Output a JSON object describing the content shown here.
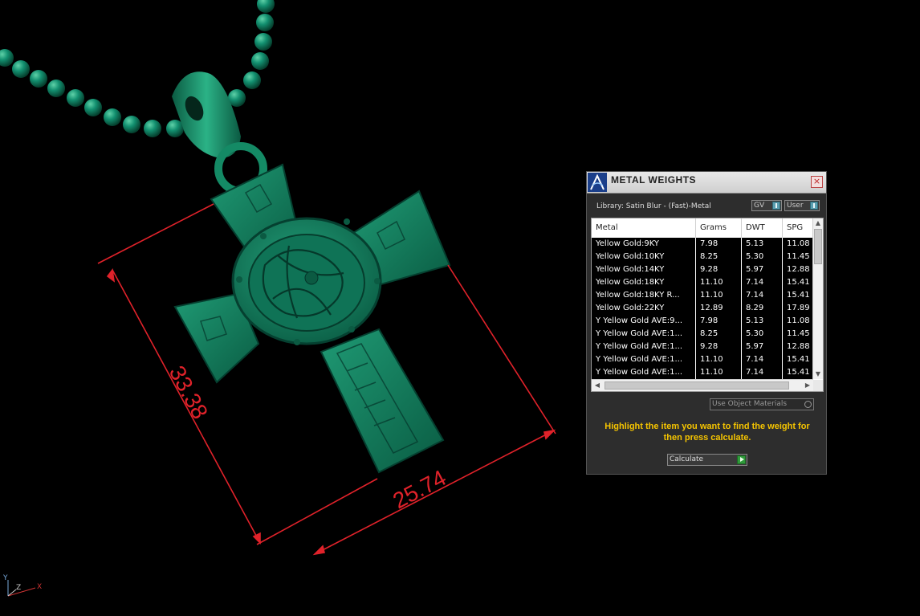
{
  "viewport": {
    "dim_height": "33.38",
    "dim_width": "25.74",
    "axis_z": "Z",
    "axis_x": "X",
    "axis_y": "Y",
    "model_color": "#117a5a",
    "dimension_color": "#e0222a"
  },
  "dialog": {
    "title": "METAL WEIGHTS",
    "close_glyph": "×",
    "library_label": "Library: Satin Blur - (Fast)-Metal",
    "toggle_gv": "GV",
    "toggle_user": "User",
    "columns": [
      "Metal",
      "Grams",
      "DWT",
      "SPG"
    ],
    "rows": [
      [
        "Yellow Gold:9KY",
        "7.98",
        "5.13",
        "11.08"
      ],
      [
        "Yellow Gold:10KY",
        "8.25",
        "5.30",
        "11.45"
      ],
      [
        "Yellow Gold:14KY",
        "9.28",
        "5.97",
        "12.88"
      ],
      [
        "Yellow Gold:18KY",
        "11.10",
        "7.14",
        "15.41"
      ],
      [
        "Yellow Gold:18KY R...",
        "11.10",
        "7.14",
        "15.41"
      ],
      [
        "Yellow Gold:22KY",
        "12.89",
        "8.29",
        "17.89"
      ],
      [
        "Y Yellow Gold AVE:9...",
        "7.98",
        "5.13",
        "11.08"
      ],
      [
        "Y Yellow Gold AVE:1...",
        "8.25",
        "5.30",
        "11.45"
      ],
      [
        "Y Yellow Gold AVE:1...",
        "9.28",
        "5.97",
        "12.88"
      ],
      [
        "Y Yellow Gold AVE:1...",
        "11.10",
        "7.14",
        "15.41"
      ],
      [
        "Y Yellow Gold AVE:1...",
        "11.10",
        "7.14",
        "15.41"
      ]
    ],
    "use_object_materials": "Use Object Materials",
    "hint": "Highlight the item you want to find the weight for then press calculate.",
    "calculate_label": "Calculate",
    "hint_color": "#f5c400"
  }
}
